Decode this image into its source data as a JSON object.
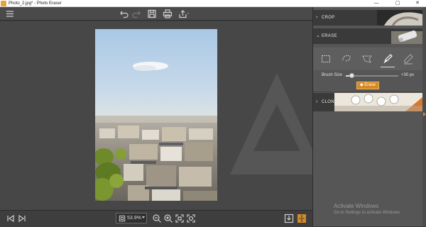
{
  "window": {
    "title": "Photo_2.jpg* - Photo Eraser",
    "controls": {
      "minimize": "—",
      "maximize": "▢",
      "close": "✕"
    }
  },
  "toolbar": {
    "items": [
      "menu-icon",
      "undo-icon",
      "redo-icon",
      "save-icon",
      "print-icon",
      "share-icon"
    ]
  },
  "statusbar": {
    "zoom_value": "53.9%"
  },
  "panel": {
    "sections": {
      "crop": {
        "label": "CROP",
        "expanded": false
      },
      "erase": {
        "label": "ERASE",
        "expanded": true
      },
      "clone": {
        "label": "CLONE",
        "expanded": false
      }
    },
    "tools": [
      "rect-select-icon",
      "lasso-icon",
      "polygon-lasso-icon",
      "brush-icon",
      "eraser-pen-icon"
    ],
    "active_tool": "brush-icon",
    "brush_size": {
      "label": "Brush Size",
      "value_label": "+30 px",
      "level": 0.12
    },
    "erase_button": {
      "label": "Erase"
    }
  },
  "overlay": {
    "activate_title": "Activate Windows",
    "activate_sub": "Go to Settings to activate Windows."
  },
  "colors": {
    "accent": "#d58a27",
    "panel": "#565656",
    "canvas": "#474747"
  }
}
